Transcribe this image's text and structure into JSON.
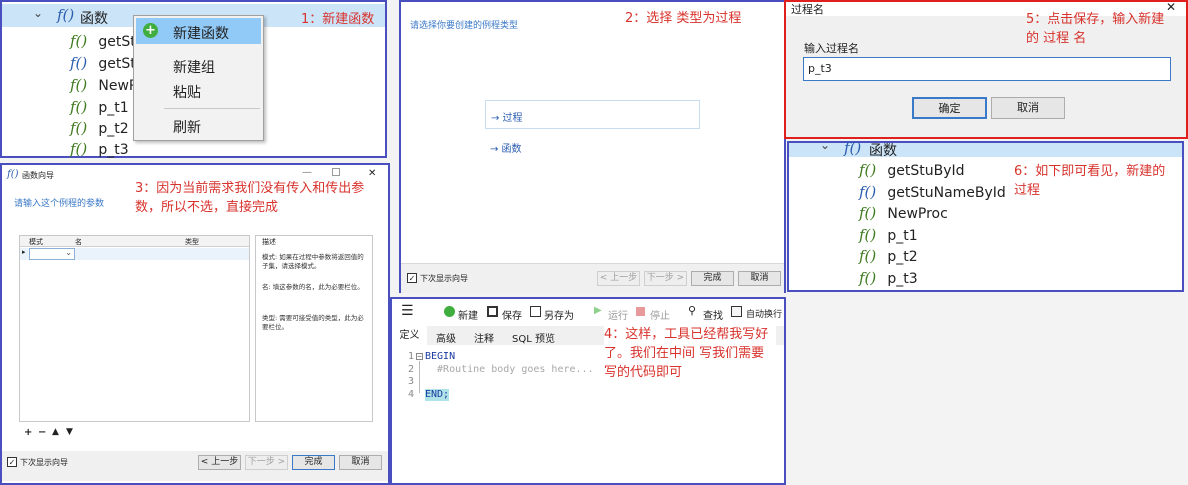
{
  "panel1": {
    "header": "函数",
    "items": [
      {
        "label": "getSt",
        "kind": "procedure"
      },
      {
        "label": "getSt",
        "kind": "function"
      },
      {
        "label": "NewP",
        "kind": "procedure"
      },
      {
        "label": "p_t1",
        "kind": "procedure"
      },
      {
        "label": "p_t2",
        "kind": "procedure"
      },
      {
        "label": "p_t3",
        "kind": "procedure"
      }
    ],
    "menu": [
      "新建函数",
      "新建组",
      "粘贴",
      "刷新"
    ],
    "annotation": "1：新建函数"
  },
  "panel2": {
    "prompt": "请选择你要创建的例程类型",
    "options": [
      "→ 过程",
      "→ 函数"
    ],
    "annotation": "2：选择 类型为过程",
    "checkbox_label": "下次显示向导",
    "buttons": [
      "< 上一步",
      "下一步 >",
      "完成",
      "取消"
    ]
  },
  "panel3": {
    "title": "函数向导",
    "prompt": "请输入这个例程的参数",
    "annotation": "3：因为当前需求我们没有传入和传出参数，所以不选，直接完成",
    "columns": [
      "模式",
      "名",
      "类型"
    ],
    "desc_title": "描述",
    "desc": [
      "模式: 如果在过程中参数将返回值的子集，请选择模式。",
      "名: 填这参数的名，此为必要栏位。",
      "类型: 需要可接受值的类型，此为必要栏位。"
    ],
    "checkbox_label": "下次显示向导",
    "buttons": [
      "< 上一步",
      "下一步 >",
      "完成",
      "取消"
    ]
  },
  "panel4": {
    "toolbar": [
      "新建",
      "保存",
      "另存为",
      "运行",
      "停止",
      "查找",
      "自动换行"
    ],
    "tabs": [
      "定义",
      "高级",
      "注释",
      "SQL 预览"
    ],
    "lines": [
      "1",
      "2",
      "3",
      "4"
    ],
    "code": [
      "BEGIN",
      "  #Routine body goes here...",
      "",
      "END;"
    ],
    "annotation": "4：这样，工具已经帮我写好了。我们在中间 写我们需要写的代码即可"
  },
  "panel5": {
    "title": "过程名",
    "label": "输入过程名",
    "value": "p_t3",
    "ok": "确定",
    "cancel": "取消",
    "annotation": "5：点击保存，输入新建的 过程 名"
  },
  "panel6": {
    "header": "函数",
    "items": [
      {
        "label": "getStuById",
        "kind": "procedure"
      },
      {
        "label": "getStuNameById",
        "kind": "function"
      },
      {
        "label": "NewProc",
        "kind": "procedure"
      },
      {
        "label": "p_t1",
        "kind": "procedure"
      },
      {
        "label": "p_t2",
        "kind": "procedure"
      },
      {
        "label": "p_t3",
        "kind": "procedure"
      }
    ],
    "annotation": "6：如下即可看见，新建的 过程"
  },
  "icons": {
    "fx": "f()",
    "close": "✕",
    "check": "✓"
  },
  "colors": {
    "annotation": "#d8322c",
    "panel_border": "#4a4fc0",
    "dialog_border": "#e0201c",
    "selection": "#cce4f7",
    "procedure": "#3e7a1e",
    "function": "#2a5db0"
  }
}
